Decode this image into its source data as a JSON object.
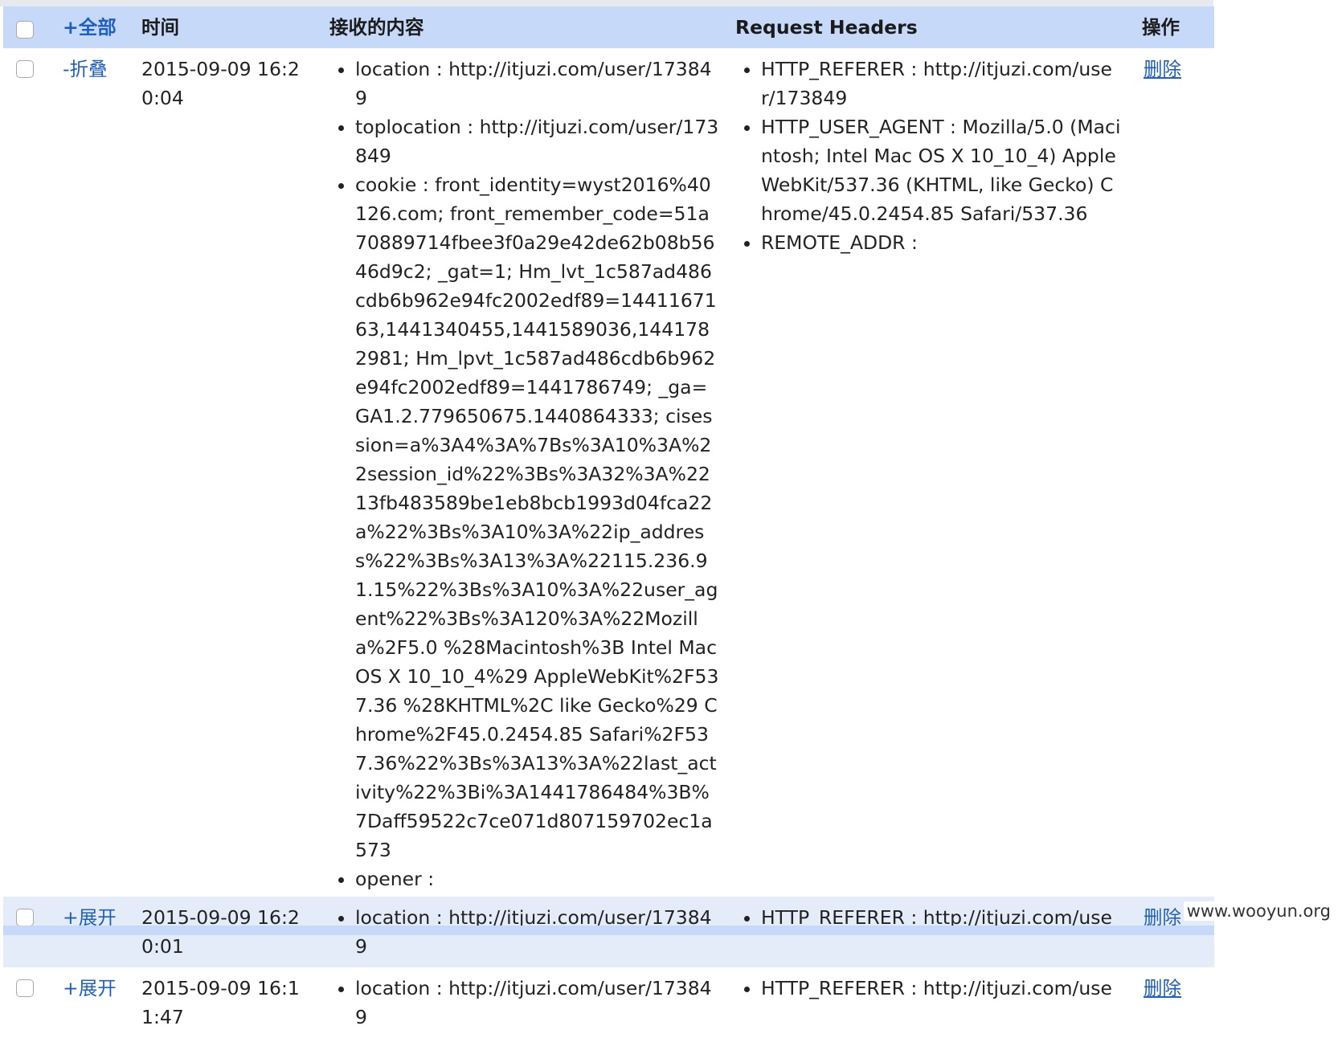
{
  "header": {
    "expand_all": "+全部",
    "time": "时间",
    "content": "接收的内容",
    "request_headers": "Request Headers",
    "actions": "操作"
  },
  "rows": [
    {
      "toggle": "-折叠",
      "time": "2015-09-09 16:20:04",
      "content": [
        "location : http://itjuzi.com/user/173849",
        "toplocation : http://itjuzi.com/user/173849",
        "cookie : front_identity=wyst2016%40126.com; front_remember_code=51a70889714fbee3f0a29e42de62b08b5646d9c2; _gat=1; Hm_lvt_1c587ad486cdb6b962e94fc2002edf89=1441167163,1441340455,1441589036,1441782981; Hm_lpvt_1c587ad486cdb6b962e94fc2002edf89=1441786749; _ga=GA1.2.779650675.1440864333; cisession=a%3A4%3A%7Bs%3A10%3A%22session_id%22%3Bs%3A32%3A%2213fb483589be1eb8bcb1993d04fca22a%22%3Bs%3A10%3A%22ip_address%22%3Bs%3A13%3A%22115.236.91.15%22%3Bs%3A10%3A%22user_agent%22%3Bs%3A120%3A%22Mozilla%2F5.0 %28Macintosh%3B Intel Mac OS X 10_10_4%29 AppleWebKit%2F537.36 %28KHTML%2C like Gecko%29 Chrome%2F45.0.2454.85 Safari%2F537.36%22%3Bs%3A13%3A%22last_activity%22%3Bi%3A1441786484%3B%7Daff59522c7ce071d807159702ec1a573",
        "opener :"
      ],
      "headers": [
        "HTTP_REFERER : http://itjuzi.com/user/173849",
        "HTTP_USER_AGENT : Mozilla/5.0 (Macintosh; Intel Mac OS X 10_10_4) AppleWebKit/537.36 (KHTML, like Gecko) Chrome/45.0.2454.85 Safari/537.36",
        "REMOTE_ADDR :"
      ],
      "action": "删除"
    },
    {
      "toggle": "+展开",
      "time": "2015-09-09 16:20:01",
      "content": [
        "location : http://itjuzi.com/user/173849"
      ],
      "headers": [
        "HTTP_REFERER : http://itjuzi.com/use"
      ],
      "action": "删除"
    },
    {
      "toggle": "+展开",
      "time": "2015-09-09 16:11:47",
      "content": [
        "location : http://itjuzi.com/user/173849"
      ],
      "headers": [
        "HTTP_REFERER : http://itjuzi.com/use"
      ],
      "action": "删除"
    }
  ],
  "watermark": "www.wooyun.org"
}
